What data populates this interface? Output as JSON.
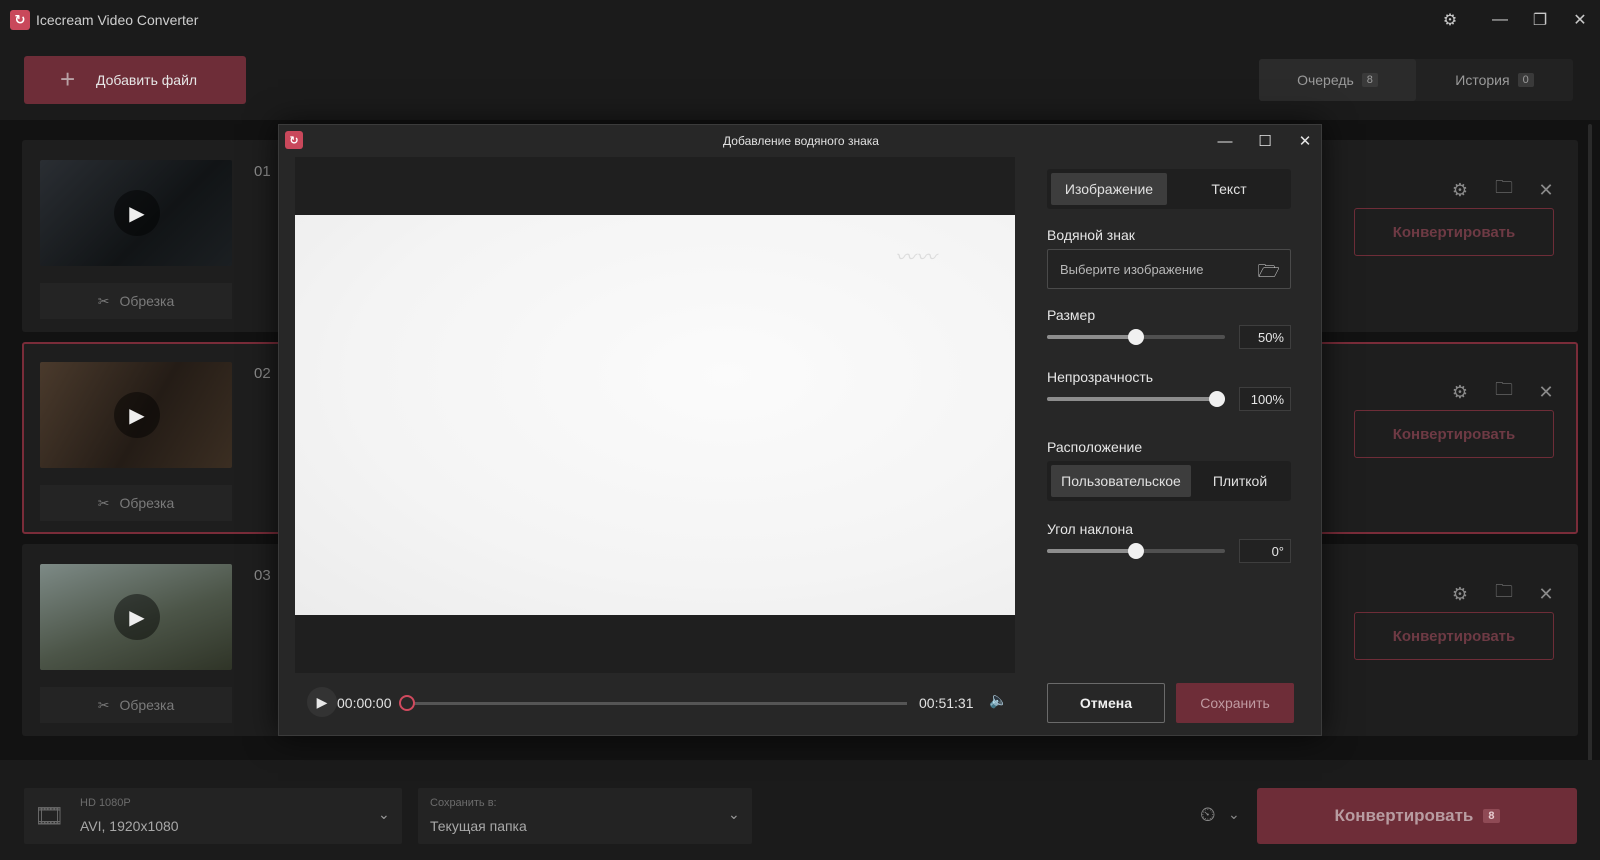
{
  "app": {
    "title": "Icecream Video Converter",
    "accent": "#c9485b"
  },
  "toolbar": {
    "add_file_label": "Добавить файл",
    "queue_label": "Очередь",
    "queue_count": "8",
    "history_label": "История",
    "history_count": "0"
  },
  "queue": {
    "trim_label": "Обрезка",
    "convert_label": "Конвертировать",
    "items": [
      {
        "index": "01"
      },
      {
        "index": "02"
      },
      {
        "index": "03"
      }
    ]
  },
  "bottom": {
    "format_quality": "HD 1080P",
    "format_value": "AVI, 1920x1080",
    "save_to_label": "Сохранить в:",
    "save_to_value": "Текущая папка",
    "convert_all_label": "Конвертировать",
    "convert_all_count": "8"
  },
  "dialog": {
    "title": "Добавление водяного знака",
    "tabs": [
      "Изображение",
      "Текст"
    ],
    "active_tab": "Изображение",
    "watermark_label": "Водяной знак",
    "watermark_placeholder": "Выберите изображение",
    "size_label": "Размер",
    "size_value": "50%",
    "size_fraction": 0.5,
    "opacity_label": "Непрозрачность",
    "opacity_value": "100%",
    "opacity_fraction": 1.0,
    "position_label": "Расположение",
    "position_options": [
      "Пользовательское",
      "Плиткой"
    ],
    "position_selected": "Пользовательское",
    "angle_label": "Угол наклона",
    "angle_value": "0°",
    "angle_fraction": 0.5,
    "time_current": "00:00:00",
    "time_total": "00:51:31",
    "playback_fraction": 0,
    "cancel_label": "Отмена",
    "save_label": "Сохранить"
  }
}
